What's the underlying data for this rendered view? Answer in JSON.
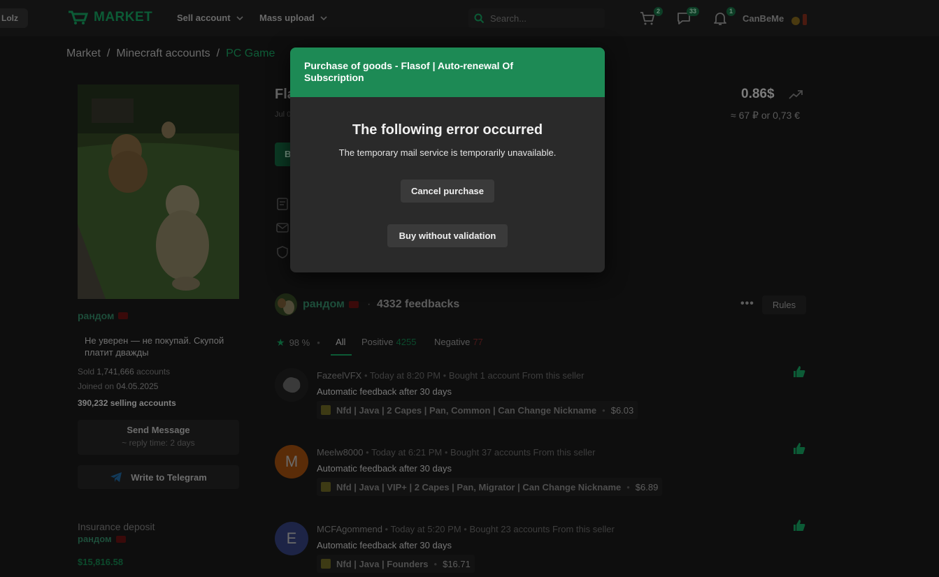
{
  "topbar": {
    "lolz_label": "Lolz",
    "logo_text": "MARKET",
    "nav": [
      {
        "label": "Sell account"
      },
      {
        "label": "Mass upload"
      }
    ],
    "search_placeholder": "Search...",
    "cart_count": "2",
    "messages_count": "33",
    "notifications_count": "1",
    "username": "CanBeMe"
  },
  "breadcrumb": {
    "items": [
      "Market",
      "/",
      "Minecraft accounts",
      "/",
      "PC Game"
    ]
  },
  "seller": {
    "name": "рандом",
    "quote": "Не уверен — не покупай. Скупой платит дважды",
    "sold_label": "Sold",
    "sold_value": "1,741,666",
    "sold_suffix": "accounts",
    "joined_label": "Joined on",
    "joined_value": "04.05.2025",
    "selling": "390,232 selling accounts",
    "send_message": "Send Message",
    "reply_time": "~ reply time: 2 days",
    "telegram": "Write to Telegram",
    "insurance_title": "Insurance deposit",
    "insurance_name": "рандом",
    "insurance_amount": "$15,816.58"
  },
  "product": {
    "title_partial": "Fla",
    "subtitle_partial": "Jul 0",
    "button_partial": "B",
    "price": "0.86$",
    "price_conversion": "≈ 67 ₽ or 0,73 €"
  },
  "feedback": {
    "seller": "рандом",
    "separator": "·",
    "count": "4332 feedbacks",
    "more": "•••",
    "rules": "Rules",
    "rating": "98 %",
    "rating_sep": "•",
    "tabs": {
      "all": "All",
      "positive": "Positive",
      "positive_count": "4255",
      "negative": "Negative",
      "negative_count": "77"
    },
    "reviews": [
      {
        "name": "FazeelVFX",
        "time": "Today at 8:20 PM",
        "bought": "Bought 1 account From this seller",
        "text": "Automatic feedback after 30 days",
        "item": "Nfd | Java | 2 Capes | Pan, Common | Can Change Nickname",
        "price": "$6.03",
        "avatar_letter": "",
        "avatar_color": "#1a1a1a"
      },
      {
        "name": "Meelw8000",
        "time": "Today at 6:21 PM",
        "bought": "Bought 37 accounts From this seller",
        "text": "Automatic feedback after 30 days",
        "item": "Nfd | Java | VIP+ | 2 Capes | Pan, Migrator | Can Change Nickname",
        "price": "$6.89",
        "avatar_letter": "M",
        "avatar_color": "#5a2c08"
      },
      {
        "name": "MCFAgommend",
        "time": "Today at 5:20 PM",
        "bought": "Bought 23 accounts From this seller",
        "text": "Automatic feedback after 30 days",
        "item": "Nfd | Java | Founders",
        "price": "$16.71",
        "avatar_letter": "E",
        "avatar_color": "#1d2446"
      }
    ]
  },
  "modal": {
    "title": "Purchase of goods - Flasof | Auto-renewal Of Subscription",
    "error_title": "The following error occurred",
    "error_message": "The temporary mail service is temporarily unavailable.",
    "cancel_label": "Cancel purchase",
    "buy_label": "Buy without validation"
  },
  "colors": {
    "modal_header": "#1d8a55",
    "modal_bg": "#2a2a2a",
    "accent_dim": "#0c5b36"
  }
}
